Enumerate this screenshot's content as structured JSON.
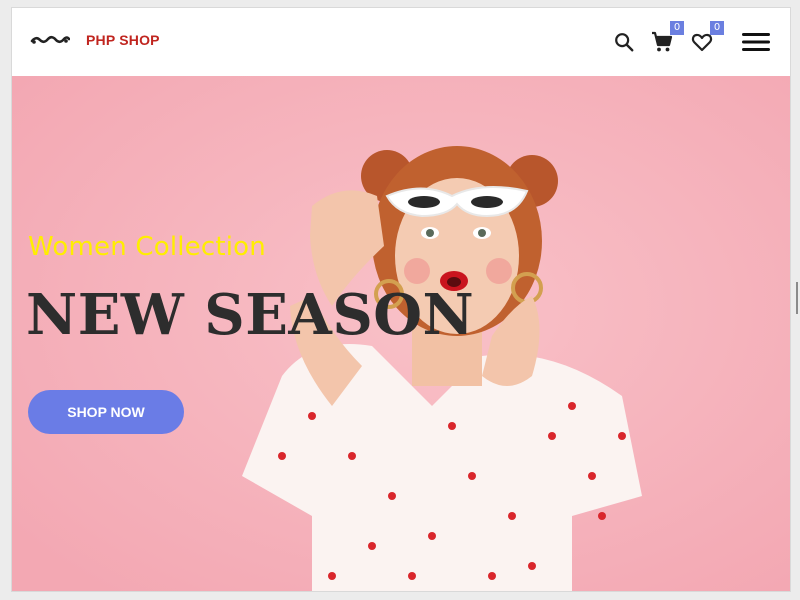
{
  "header": {
    "brand": "PHP SHOP",
    "cart_count": "0",
    "wishlist_count": "0"
  },
  "hero": {
    "subtitle": "Women Collection",
    "title": "NEW SEASON",
    "cta_label": "SHOP NOW"
  },
  "colors": {
    "brand_red": "#c0251f",
    "accent": "#6a7ce6",
    "hero_bg": "#f6b3bc",
    "subtitle_yellow": "#ffee00"
  },
  "icons": [
    "logo-mark",
    "search-icon",
    "cart-icon",
    "heart-icon",
    "menu-icon"
  ]
}
